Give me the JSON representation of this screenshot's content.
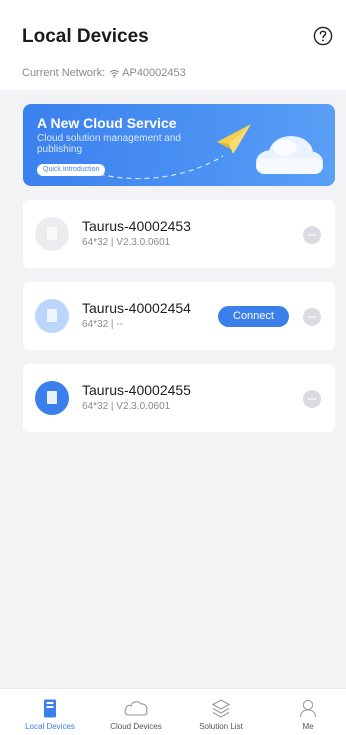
{
  "header": {
    "title": "Local Devices",
    "network_label": "Current Network:",
    "network_ssid": "AP40002453"
  },
  "banner": {
    "title": "A New Cloud Service",
    "subtitle": "Cloud solution management and publishing",
    "button_label": "Quick Introduction"
  },
  "devices": [
    {
      "name": "Taurus-40002453",
      "meta": "64*32 | V2.3.0.0601",
      "status": "offline"
    },
    {
      "name": "Taurus-40002454",
      "meta": "64*32 | --",
      "status": "available",
      "connect_label": "Connect"
    },
    {
      "name": "Taurus-40002455",
      "meta": "64*32 | V2.3.0.0601",
      "status": "connected"
    }
  ],
  "tabs": [
    {
      "label": "Local Devices",
      "icon": "local-device-icon",
      "active": true
    },
    {
      "label": "Cloud Devices",
      "icon": "cloud-icon",
      "active": false
    },
    {
      "label": "Solution List",
      "icon": "layers-icon",
      "active": false
    },
    {
      "label": "Me",
      "icon": "person-icon",
      "active": false
    }
  ],
  "colors": {
    "accent": "#3b7fec",
    "background": "#f3f3f5",
    "muted_text": "#8a8a8a"
  }
}
